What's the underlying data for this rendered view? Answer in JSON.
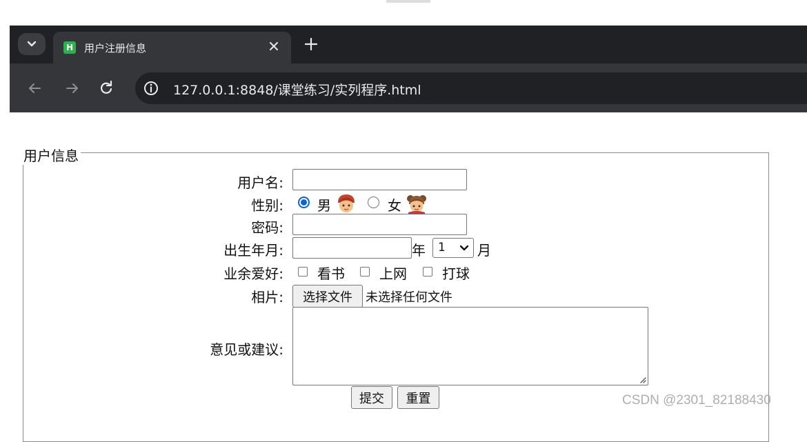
{
  "tab": {
    "title": "用户注册信息",
    "favicon_letter": "H"
  },
  "address_bar": {
    "url": "127.0.0.1:8848/课堂练习/实列程序.html"
  },
  "form": {
    "legend": "用户信息",
    "username": {
      "label": "用户名:",
      "value": ""
    },
    "gender": {
      "label": "性别:",
      "options": [
        {
          "label": "男",
          "checked": true
        },
        {
          "label": "女",
          "checked": false
        }
      ]
    },
    "password": {
      "label": "密码:",
      "value": ""
    },
    "birth": {
      "label": "出生年月:",
      "year_value": "",
      "year_suffix": "年",
      "month_value": "1",
      "month_suffix": "月"
    },
    "hobbies": {
      "label": "业余爱好:",
      "options": [
        {
          "label": "看书",
          "checked": false
        },
        {
          "label": "上网",
          "checked": false
        },
        {
          "label": "打球",
          "checked": false
        }
      ]
    },
    "photo": {
      "label": "相片:",
      "button_label": "选择文件",
      "status": "未选择任何文件"
    },
    "suggestion": {
      "label": "意见或建议:",
      "value": ""
    },
    "submit_label": "提交",
    "reset_label": "重置"
  },
  "watermark": "CSDN @2301_82188430",
  "colors": {
    "tab_strip": "#202124",
    "toolbar": "#35363a",
    "radio_accent": "#0b63d6",
    "favicon": "#2bb24c"
  }
}
